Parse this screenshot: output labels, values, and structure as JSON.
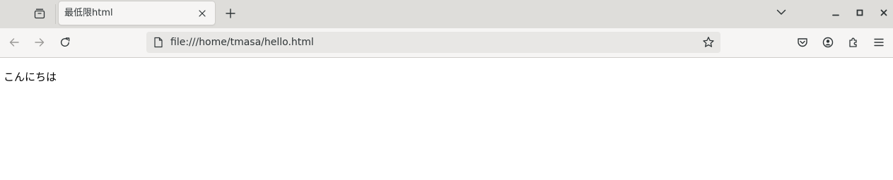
{
  "titlebar": {
    "tab": {
      "title": "最低限html"
    },
    "icons": {
      "overview": "tab-overview-icon",
      "close": "close-icon",
      "new_tab": "plus-icon",
      "tab_list": "chevron-down-icon",
      "minimize": "minimize-icon",
      "maximize": "maximize-icon",
      "window_close": "window-close-icon"
    }
  },
  "toolbar": {
    "url": "file:///home/tmasa/hello.html",
    "icons": {
      "back": "back-arrow-icon",
      "forward": "forward-arrow-icon",
      "reload": "reload-icon",
      "page": "page-icon",
      "bookmark": "star-icon",
      "pocket": "pocket-icon",
      "account": "account-icon",
      "extensions": "puzzle-icon",
      "menu": "hamburger-menu-icon"
    }
  },
  "page": {
    "text": "こんにちは"
  },
  "colors": {
    "titlebar_bg": "#deddda",
    "toolbar_bg": "#f6f5f4",
    "urlbar_bg": "#e8e7e5",
    "icon": "#2e3436",
    "icon_disabled": "#9a9996"
  }
}
